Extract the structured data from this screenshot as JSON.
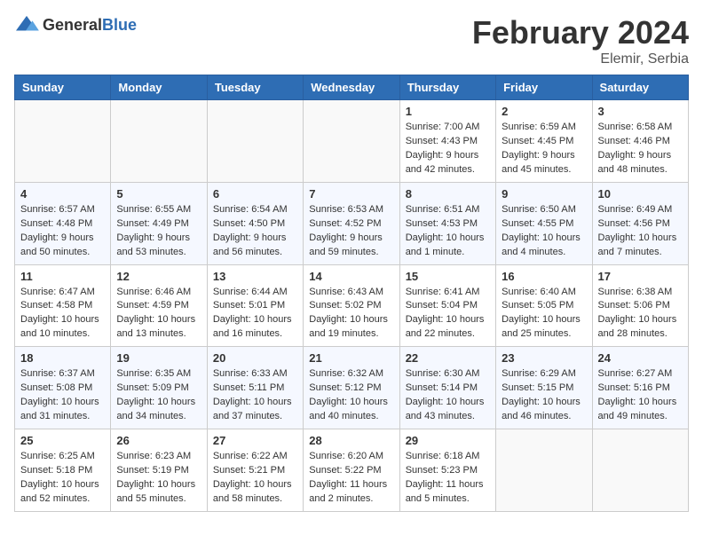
{
  "header": {
    "logo_general": "General",
    "logo_blue": "Blue",
    "title": "February 2024",
    "location": "Elemir, Serbia"
  },
  "days_of_week": [
    "Sunday",
    "Monday",
    "Tuesday",
    "Wednesday",
    "Thursday",
    "Friday",
    "Saturday"
  ],
  "weeks": [
    [
      {
        "day": "",
        "info": ""
      },
      {
        "day": "",
        "info": ""
      },
      {
        "day": "",
        "info": ""
      },
      {
        "day": "",
        "info": ""
      },
      {
        "day": "1",
        "info": "Sunrise: 7:00 AM\nSunset: 4:43 PM\nDaylight: 9 hours\nand 42 minutes."
      },
      {
        "day": "2",
        "info": "Sunrise: 6:59 AM\nSunset: 4:45 PM\nDaylight: 9 hours\nand 45 minutes."
      },
      {
        "day": "3",
        "info": "Sunrise: 6:58 AM\nSunset: 4:46 PM\nDaylight: 9 hours\nand 48 minutes."
      }
    ],
    [
      {
        "day": "4",
        "info": "Sunrise: 6:57 AM\nSunset: 4:48 PM\nDaylight: 9 hours\nand 50 minutes."
      },
      {
        "day": "5",
        "info": "Sunrise: 6:55 AM\nSunset: 4:49 PM\nDaylight: 9 hours\nand 53 minutes."
      },
      {
        "day": "6",
        "info": "Sunrise: 6:54 AM\nSunset: 4:50 PM\nDaylight: 9 hours\nand 56 minutes."
      },
      {
        "day": "7",
        "info": "Sunrise: 6:53 AM\nSunset: 4:52 PM\nDaylight: 9 hours\nand 59 minutes."
      },
      {
        "day": "8",
        "info": "Sunrise: 6:51 AM\nSunset: 4:53 PM\nDaylight: 10 hours\nand 1 minute."
      },
      {
        "day": "9",
        "info": "Sunrise: 6:50 AM\nSunset: 4:55 PM\nDaylight: 10 hours\nand 4 minutes."
      },
      {
        "day": "10",
        "info": "Sunrise: 6:49 AM\nSunset: 4:56 PM\nDaylight: 10 hours\nand 7 minutes."
      }
    ],
    [
      {
        "day": "11",
        "info": "Sunrise: 6:47 AM\nSunset: 4:58 PM\nDaylight: 10 hours\nand 10 minutes."
      },
      {
        "day": "12",
        "info": "Sunrise: 6:46 AM\nSunset: 4:59 PM\nDaylight: 10 hours\nand 13 minutes."
      },
      {
        "day": "13",
        "info": "Sunrise: 6:44 AM\nSunset: 5:01 PM\nDaylight: 10 hours\nand 16 minutes."
      },
      {
        "day": "14",
        "info": "Sunrise: 6:43 AM\nSunset: 5:02 PM\nDaylight: 10 hours\nand 19 minutes."
      },
      {
        "day": "15",
        "info": "Sunrise: 6:41 AM\nSunset: 5:04 PM\nDaylight: 10 hours\nand 22 minutes."
      },
      {
        "day": "16",
        "info": "Sunrise: 6:40 AM\nSunset: 5:05 PM\nDaylight: 10 hours\nand 25 minutes."
      },
      {
        "day": "17",
        "info": "Sunrise: 6:38 AM\nSunset: 5:06 PM\nDaylight: 10 hours\nand 28 minutes."
      }
    ],
    [
      {
        "day": "18",
        "info": "Sunrise: 6:37 AM\nSunset: 5:08 PM\nDaylight: 10 hours\nand 31 minutes."
      },
      {
        "day": "19",
        "info": "Sunrise: 6:35 AM\nSunset: 5:09 PM\nDaylight: 10 hours\nand 34 minutes."
      },
      {
        "day": "20",
        "info": "Sunrise: 6:33 AM\nSunset: 5:11 PM\nDaylight: 10 hours\nand 37 minutes."
      },
      {
        "day": "21",
        "info": "Sunrise: 6:32 AM\nSunset: 5:12 PM\nDaylight: 10 hours\nand 40 minutes."
      },
      {
        "day": "22",
        "info": "Sunrise: 6:30 AM\nSunset: 5:14 PM\nDaylight: 10 hours\nand 43 minutes."
      },
      {
        "day": "23",
        "info": "Sunrise: 6:29 AM\nSunset: 5:15 PM\nDaylight: 10 hours\nand 46 minutes."
      },
      {
        "day": "24",
        "info": "Sunrise: 6:27 AM\nSunset: 5:16 PM\nDaylight: 10 hours\nand 49 minutes."
      }
    ],
    [
      {
        "day": "25",
        "info": "Sunrise: 6:25 AM\nSunset: 5:18 PM\nDaylight: 10 hours\nand 52 minutes."
      },
      {
        "day": "26",
        "info": "Sunrise: 6:23 AM\nSunset: 5:19 PM\nDaylight: 10 hours\nand 55 minutes."
      },
      {
        "day": "27",
        "info": "Sunrise: 6:22 AM\nSunset: 5:21 PM\nDaylight: 10 hours\nand 58 minutes."
      },
      {
        "day": "28",
        "info": "Sunrise: 6:20 AM\nSunset: 5:22 PM\nDaylight: 11 hours\nand 2 minutes."
      },
      {
        "day": "29",
        "info": "Sunrise: 6:18 AM\nSunset: 5:23 PM\nDaylight: 11 hours\nand 5 minutes."
      },
      {
        "day": "",
        "info": ""
      },
      {
        "day": "",
        "info": ""
      }
    ]
  ]
}
